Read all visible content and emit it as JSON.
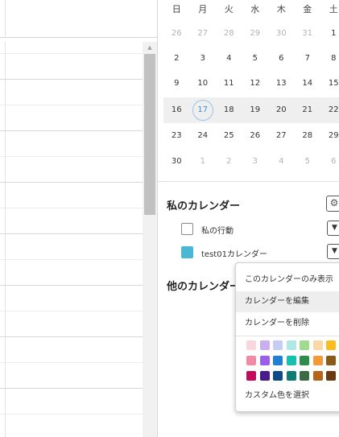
{
  "mini_calendar": {
    "weekdays": [
      "日",
      "月",
      "火",
      "水",
      "木",
      "金",
      "土"
    ],
    "weeks": [
      [
        "26",
        "27",
        "28",
        "29",
        "30",
        "31",
        "1"
      ],
      [
        "2",
        "3",
        "4",
        "5",
        "6",
        "7",
        "8"
      ],
      [
        "9",
        "10",
        "11",
        "12",
        "13",
        "14",
        "15"
      ],
      [
        "16",
        "17",
        "18",
        "19",
        "20",
        "21",
        "22"
      ],
      [
        "23",
        "24",
        "25",
        "26",
        "27",
        "28",
        "29"
      ],
      [
        "30",
        "1",
        "2",
        "3",
        "4",
        "5",
        "6"
      ]
    ],
    "today": "17",
    "highlighted_week": 3
  },
  "my_calendars": {
    "title": "私のカレンダー",
    "settings_icon": "gear-icon",
    "items": [
      {
        "label": "私の行動",
        "checked": false,
        "color": "#ffffff"
      },
      {
        "label": "test01カレンダー",
        "checked": true,
        "color": "#4ab8d4"
      }
    ]
  },
  "other_calendars": {
    "title": "他のカレンダー"
  },
  "context_menu": {
    "items": [
      {
        "label": "このカレンダーのみ表示"
      },
      {
        "label": "カレンダーを編集",
        "active": true
      },
      {
        "label": "カレンダーを削除"
      }
    ],
    "custom_color_label": "カスタム色を選択",
    "color_palette": [
      [
        "#fad7e0",
        "#c9aef0",
        "#c3cdf5",
        "#aee9e3",
        "#9fdc8f",
        "#fbd8a5",
        "#fbbd1d"
      ],
      [
        "#f18ba5",
        "#9b5ee8",
        "#1e7fd4",
        "#13c1ad",
        "#2e8b4c",
        "#f39a3a",
        "#8a5a16"
      ],
      [
        "#c40a5c",
        "#4a1a8c",
        "#0e4a8a",
        "#0f7c74",
        "#3a6b45",
        "#b5641a",
        "#6a3a12"
      ]
    ]
  }
}
